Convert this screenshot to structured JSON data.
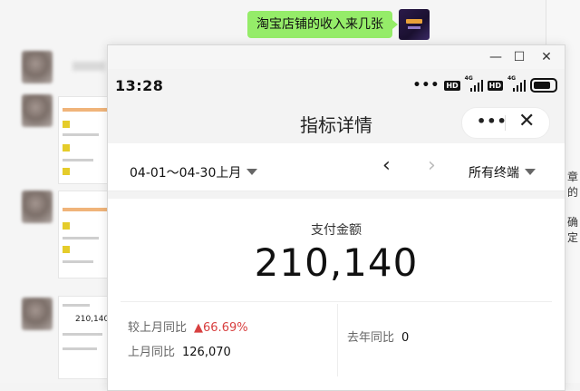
{
  "chat": {
    "message": "淘宝店铺的收入来几张",
    "right_fragments": [
      "章的",
      "确定"
    ]
  },
  "window": {
    "controls": {
      "minimize": "—",
      "maximize": "☐",
      "close": "✕"
    }
  },
  "statusbar": {
    "time": "13:28",
    "dots": "•••",
    "hd_badge": "HD",
    "network": "4G"
  },
  "navbar": {
    "title": "指标详情",
    "more": "•••",
    "close": "✕"
  },
  "filters": {
    "date_range": "04-01～04-30上月",
    "prev": "‹",
    "next": "›",
    "terminal": "所有终端"
  },
  "metric": {
    "label": "支付金额",
    "value": "210,140",
    "mom_label": "较上月同比",
    "mom_change": "▲66.69%",
    "last_month_label": "上月同比",
    "last_month_value": "126,070",
    "yoy_label": "去年同比",
    "yoy_value": "0"
  },
  "thumbnails": {
    "preview_value": "210,140"
  },
  "colors": {
    "bubble": "#95ec69",
    "increase": "#d84040"
  }
}
